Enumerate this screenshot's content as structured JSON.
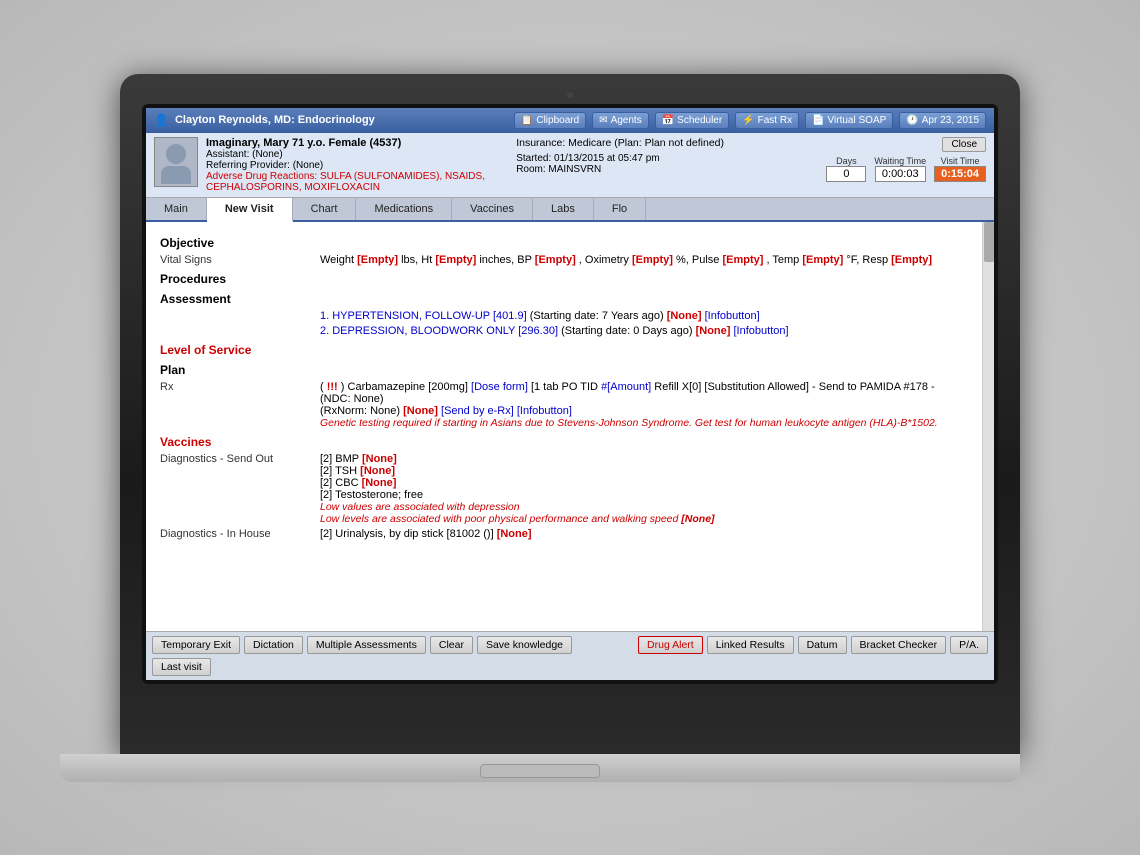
{
  "header": {
    "provider": "Clayton Reynolds, MD: Endocrinology",
    "buttons": {
      "clipboard": "Clipboard",
      "agents": "Agents",
      "scheduler": "Scheduler",
      "fastRx": "Fast Rx",
      "virtualSoap": "Virtual SOAP",
      "date": "Apr 23, 2015"
    }
  },
  "patient": {
    "name": "Imaginary, Mary 71 y.o. Female (4537)",
    "assistant": "Assistant: (None)",
    "referring": "Referring Provider: (None)",
    "adr": "Adverse Drug Reactions: SULFA (SULFONAMIDES), NSAIDS, CEPHALOSPORINS, MOXIFLOXACIN",
    "insurance": "Insurance: Medicare (Plan: Plan not defined)",
    "started": "Started: 01/13/2015 at 05:47 pm",
    "room": "Room: MAINSVRN",
    "days_label": "Days",
    "days_val": "0",
    "waiting_label": "Waiting Time",
    "waiting_val": "0:00:03",
    "visit_label": "Visit Time",
    "visit_val": "0:15:04",
    "close_btn": "Close"
  },
  "tabs": [
    {
      "label": "Main",
      "active": false
    },
    {
      "label": "New Visit",
      "active": true
    },
    {
      "label": "Chart",
      "active": false
    },
    {
      "label": "Medications",
      "active": false
    },
    {
      "label": "Vaccines",
      "active": false
    },
    {
      "label": "Labs",
      "active": false
    },
    {
      "label": "Flo",
      "active": false
    }
  ],
  "content": {
    "objective_title": "Objective",
    "vital_signs_label": "Vital Signs",
    "vital_signs_text": "Weight [Empty] lbs, Ht [Empty] inches, BP [Empty] , Oximetry [Empty] %, Pulse [Empty] , Temp [Empty] °F, Resp [Empty]",
    "procedures_title": "Procedures",
    "assessment_title": "Assessment",
    "assessment_items": [
      "1. HYPERTENSION, FOLLOW-UP [401.9]   (Starting date: 7 Years ago)[None] [Infobutton]",
      "2. DEPRESSION, BLOODWORK ONLY [296.30]   (Starting date: 0 Days ago)[None] [Infobutton]"
    ],
    "level_of_service_title": "Level of Service",
    "plan_title": "Plan",
    "rx_label": "Rx",
    "rx_text": "( !!! )   Carbamazepine [200mg] [Dose form] [1 tab PO TID #[Amount] Refill X[0] [Substitution Allowed] - Send to PAMIDA #178 - (NDC: None) (RxNorm: None)[None] [Send by e-Rx] [Infobutton]",
    "rx_warning": "Genetic testing required if starting in Asians due to Stevens-Johnson Syndrome. Get test for human leukocyte antigen (HLA)-B*1502.",
    "vaccines_title": "Vaccines",
    "diagnostics_send_label": "Diagnostics - Send Out",
    "diagnostics_items": [
      "[2] BMP [None]",
      "[2] TSH [None]",
      "[2] CBC [None]",
      "[2] Testosterone; free",
      "Low values are associated with depression",
      "Low levels are associated with poor physical performance and walking speed [None]"
    ],
    "diagnostics_inhouse_label": "Diagnostics - In House",
    "diagnostics_inhouse_items": [
      "[2] Urinalysis, by dip stick  [81002  ()] [None]"
    ]
  },
  "bottom_buttons": [
    {
      "label": "Temporary Exit",
      "type": "normal"
    },
    {
      "label": "Dictation",
      "type": "normal"
    },
    {
      "label": "Multiple Assessments",
      "type": "normal"
    },
    {
      "label": "Clear",
      "type": "normal"
    },
    {
      "label": "Save knowledge",
      "type": "normal"
    },
    {
      "label": "Drug Alert",
      "type": "red"
    },
    {
      "label": "Linked Results",
      "type": "normal"
    },
    {
      "label": "Datum",
      "type": "normal"
    },
    {
      "label": "Bracket Checker",
      "type": "normal"
    },
    {
      "label": "P/A.",
      "type": "normal"
    },
    {
      "label": "Last visit",
      "type": "normal"
    }
  ]
}
